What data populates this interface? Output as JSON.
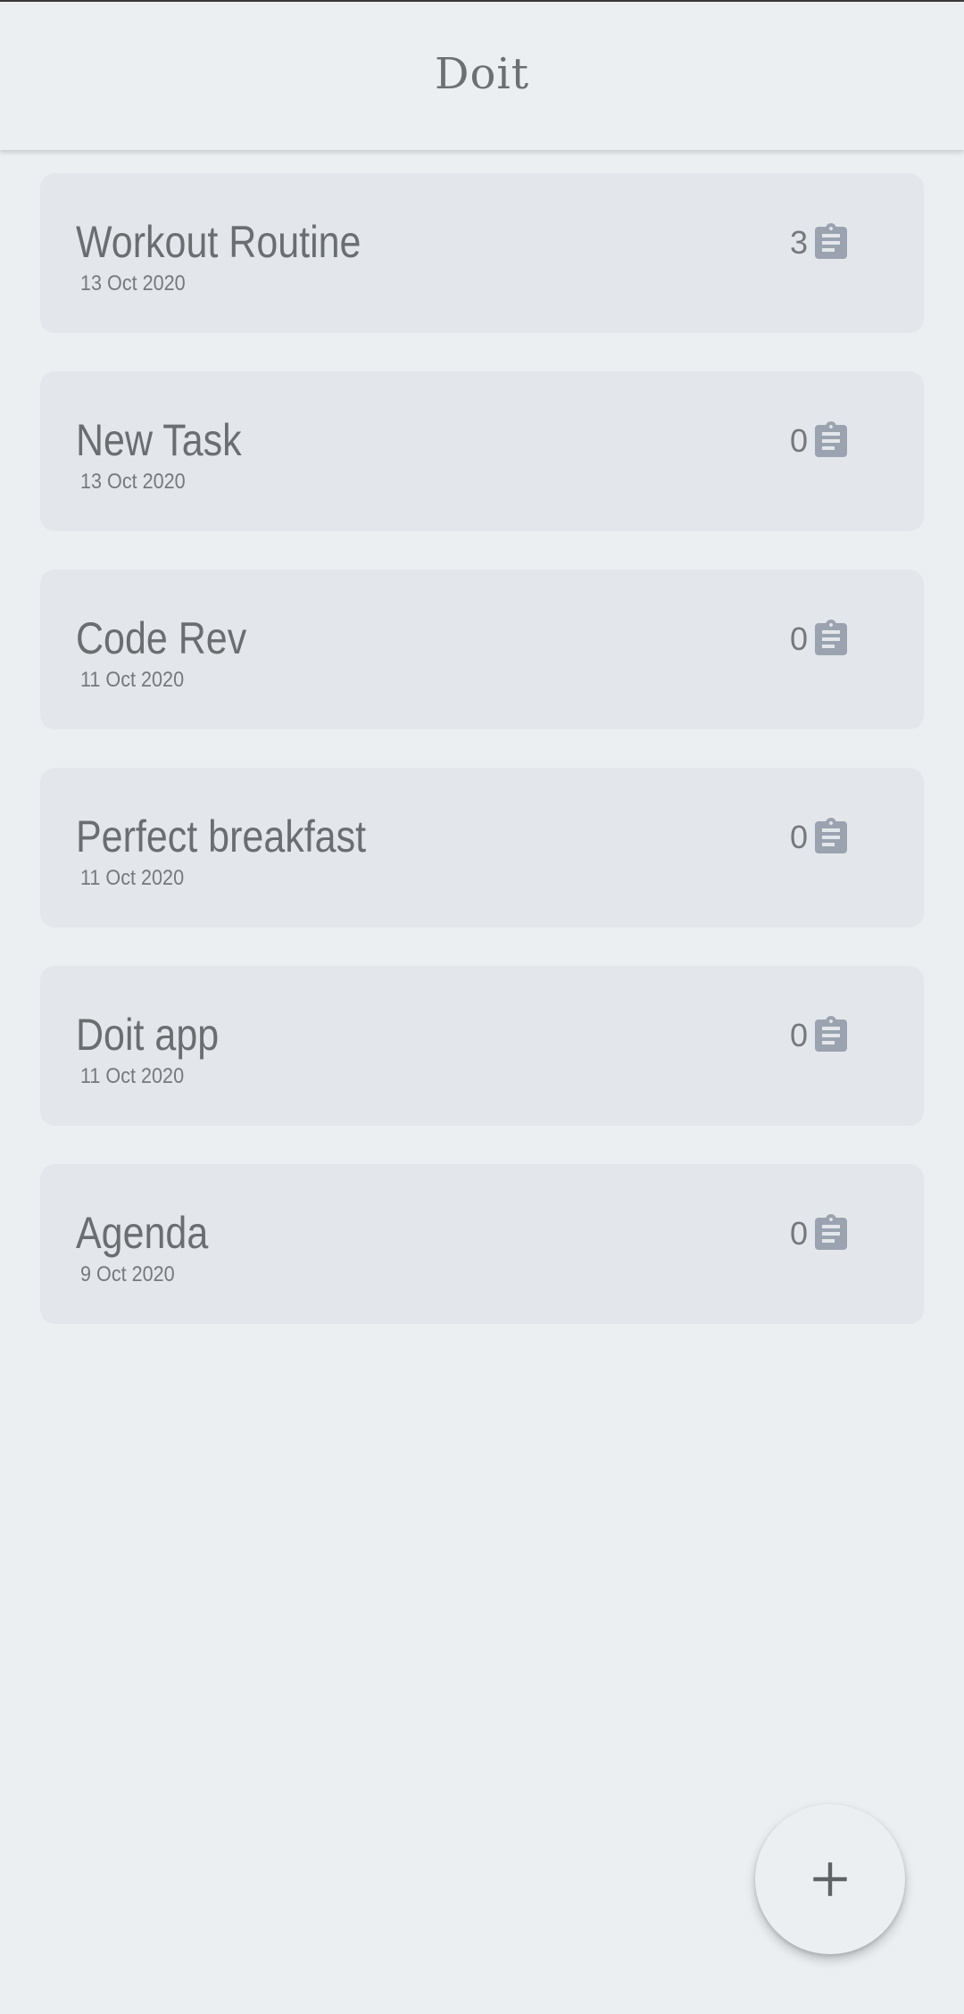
{
  "app": {
    "title": "Doit"
  },
  "tasks": [
    {
      "title": "Workout Routine",
      "date": "13 Oct 2020",
      "count": "3",
      "icon": "clipboard-icon"
    },
    {
      "title": "New Task",
      "date": "13 Oct 2020",
      "count": "0",
      "icon": "clipboard-icon"
    },
    {
      "title": "Code Rev",
      "date": "11 Oct 2020",
      "count": "0",
      "icon": "clipboard-icon"
    },
    {
      "title": "Perfect breakfast",
      "date": "11 Oct 2020",
      "count": "0",
      "icon": "clipboard-icon"
    },
    {
      "title": "Doit app",
      "date": "11 Oct 2020",
      "count": "0",
      "icon": "clipboard-icon"
    },
    {
      "title": "Agenda",
      "date": "9 Oct 2020",
      "count": "0",
      "icon": "clipboard-icon"
    }
  ],
  "fab": {
    "icon": "plus-icon"
  },
  "colors": {
    "background": "#ECEFF2",
    "card": "#E3E7EB",
    "text": "#6B6E71",
    "icon": "#9BA3B0"
  }
}
